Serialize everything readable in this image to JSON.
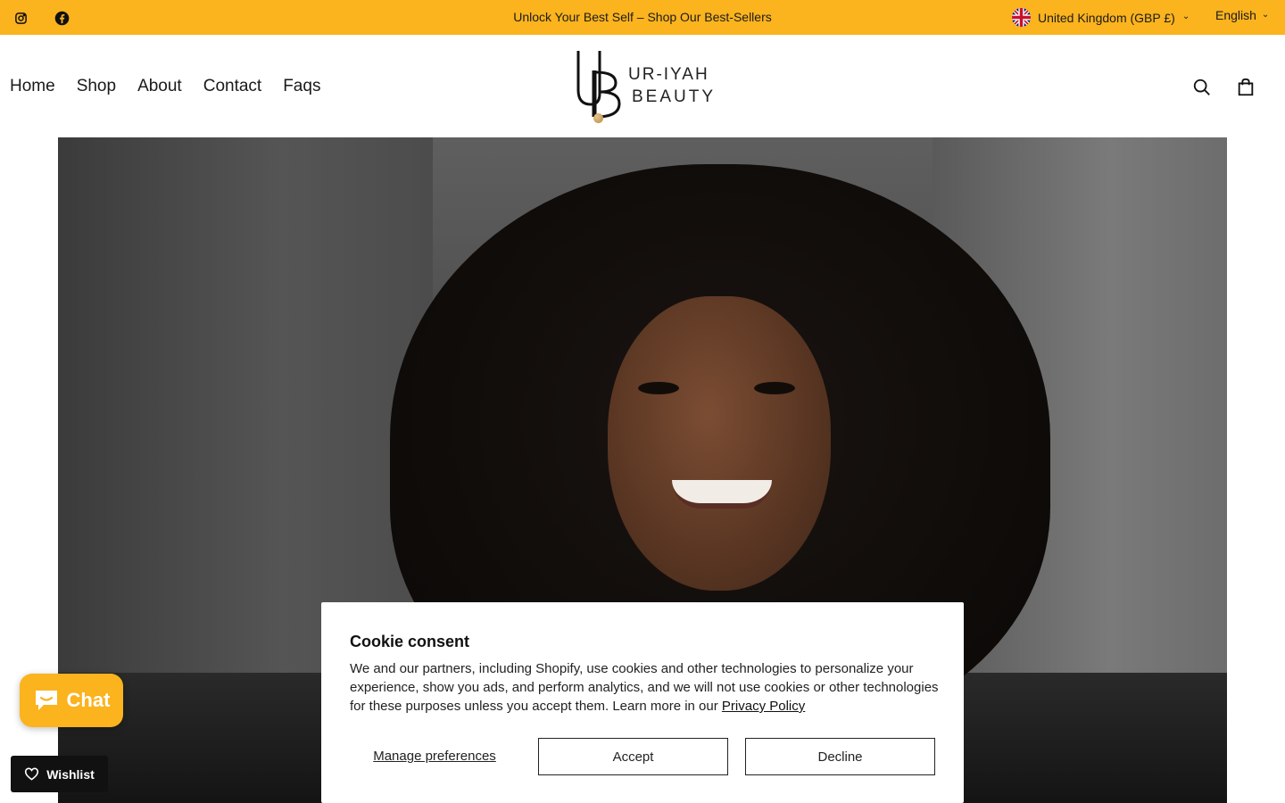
{
  "colors": {
    "accent": "#FBB31E",
    "text": "#111111",
    "white": "#ffffff"
  },
  "topbar": {
    "social": [
      {
        "name": "instagram-icon"
      },
      {
        "name": "facebook-icon"
      }
    ],
    "announcement": "Unlock Your Best Self – Shop Our Best-Sellers",
    "country": "United Kingdom (GBP £)",
    "language": "English"
  },
  "header": {
    "nav": [
      "Home",
      "Shop",
      "About",
      "Contact",
      "Faqs"
    ],
    "logo": {
      "line1": "UR-IYAH",
      "line2": "BEAUTY"
    },
    "icons": [
      "search-icon",
      "cart-icon"
    ]
  },
  "cookie": {
    "title": "Cookie consent",
    "body": "We and our partners, including Shopify, use cookies and other technologies to personalize your experience, show you ads, and perform analytics, and we will not use cookies or other technologies for these purposes unless you accept them. Learn more in our ",
    "policy_link": "Privacy Policy",
    "manage": "Manage preferences",
    "accept": "Accept",
    "decline": "Decline"
  },
  "chat": {
    "label": "Chat"
  },
  "wishlist": {
    "label": "Wishlist"
  }
}
